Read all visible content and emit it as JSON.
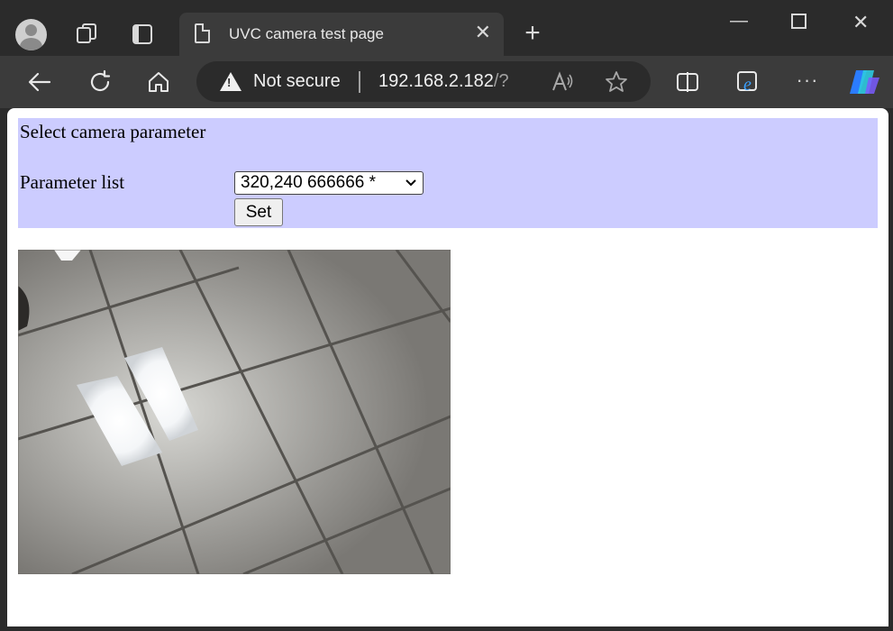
{
  "browser": {
    "tab_title": "UVC camera test page",
    "security_label": "Not secure",
    "url_host": "192.168.2.182",
    "url_rest": "/?"
  },
  "page": {
    "panel_title": "Select camera parameter",
    "param_label": "Parameter list",
    "param_selected": "320,240 666666 *",
    "set_label": "Set"
  }
}
